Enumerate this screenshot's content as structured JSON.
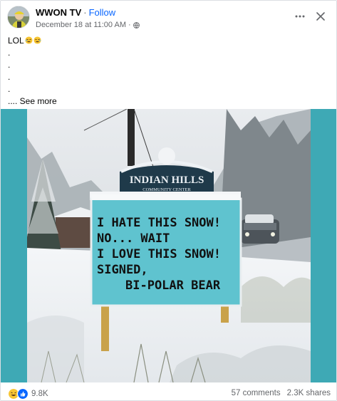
{
  "post": {
    "page_name": "WWON TV",
    "separator": "·",
    "follow_label": "Follow",
    "timestamp": "December 18 at 11:00 AM",
    "meta_separator": "·",
    "audience_icon": "globe-icon",
    "more_icon": "more-horizontal-icon",
    "close_icon": "close-icon"
  },
  "caption": {
    "text": "LOL",
    "emojis": [
      "rolling-on-floor-laughing-emoji",
      "rolling-on-floor-laughing-emoji"
    ],
    "dots": [
      ".",
      ".",
      ".",
      "."
    ],
    "see_more": ".... See more"
  },
  "image": {
    "sign_header": "INDIAN HILLS",
    "sign_subheader": "COMMUNITY CENTER",
    "sign_lines": [
      "I HATE THIS SNOW!",
      "NO... WAIT",
      "I LOVE THIS SNOW!",
      "SIGNED,",
      "BI-POLAR BEAR"
    ]
  },
  "footer": {
    "reaction_icons": [
      "haha-reaction-icon",
      "like-reaction-icon"
    ],
    "reaction_count": "9.8K",
    "comments": "57 comments",
    "shares": "2.3K shares"
  },
  "colors": {
    "accent": "#0866ff",
    "media_background": "#3ea9b5",
    "sign_board": "#5fc3cf",
    "secondary_text": "#65676b"
  }
}
